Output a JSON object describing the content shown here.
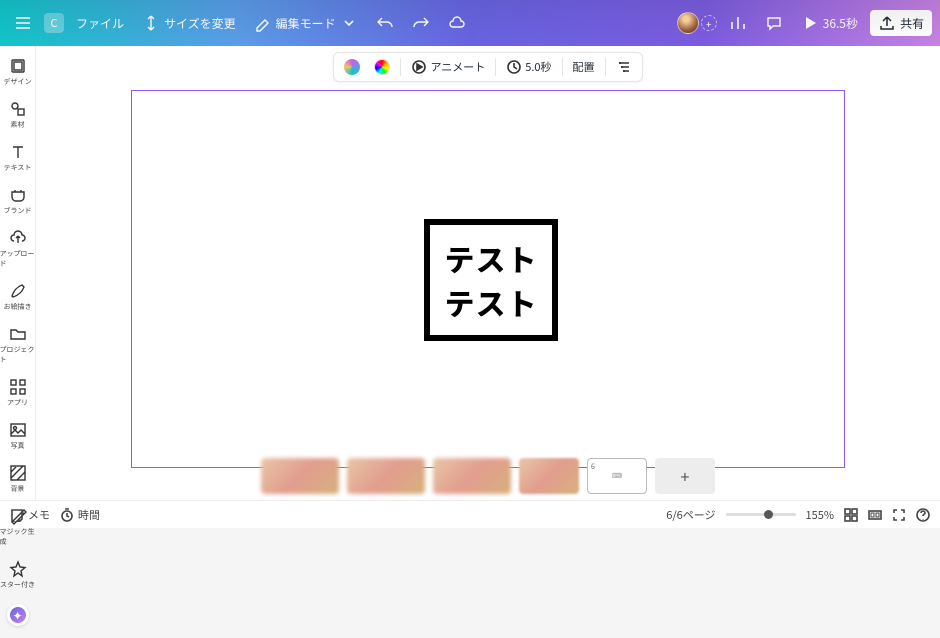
{
  "topbar": {
    "file": "ファイル",
    "resize": "サイズを変更",
    "edit_mode": "編集モード",
    "play_duration": "36.5秒",
    "share": "共有"
  },
  "sidebar": {
    "items": [
      {
        "label": "デザイン",
        "icon": "design"
      },
      {
        "label": "素材",
        "icon": "elements"
      },
      {
        "label": "テキスト",
        "icon": "text"
      },
      {
        "label": "ブランド",
        "icon": "brand"
      },
      {
        "label": "アップロード",
        "icon": "upload"
      },
      {
        "label": "お絵描き",
        "icon": "draw"
      },
      {
        "label": "プロジェクト",
        "icon": "projects"
      },
      {
        "label": "アプリ",
        "icon": "apps"
      },
      {
        "label": "写真",
        "icon": "photos"
      },
      {
        "label": "背景",
        "icon": "background"
      },
      {
        "label": "マジック生成",
        "icon": "magic"
      },
      {
        "label": "スター付き",
        "icon": "star"
      }
    ]
  },
  "ctxbar": {
    "animate": "アニメート",
    "duration": "5.0秒",
    "position": "配置"
  },
  "canvas": {
    "line1": "テスト",
    "line2": "テスト"
  },
  "footer": {
    "notes": "メモ",
    "timer": "時間",
    "page_indicator": "6/6ページ",
    "zoom": "155%"
  }
}
